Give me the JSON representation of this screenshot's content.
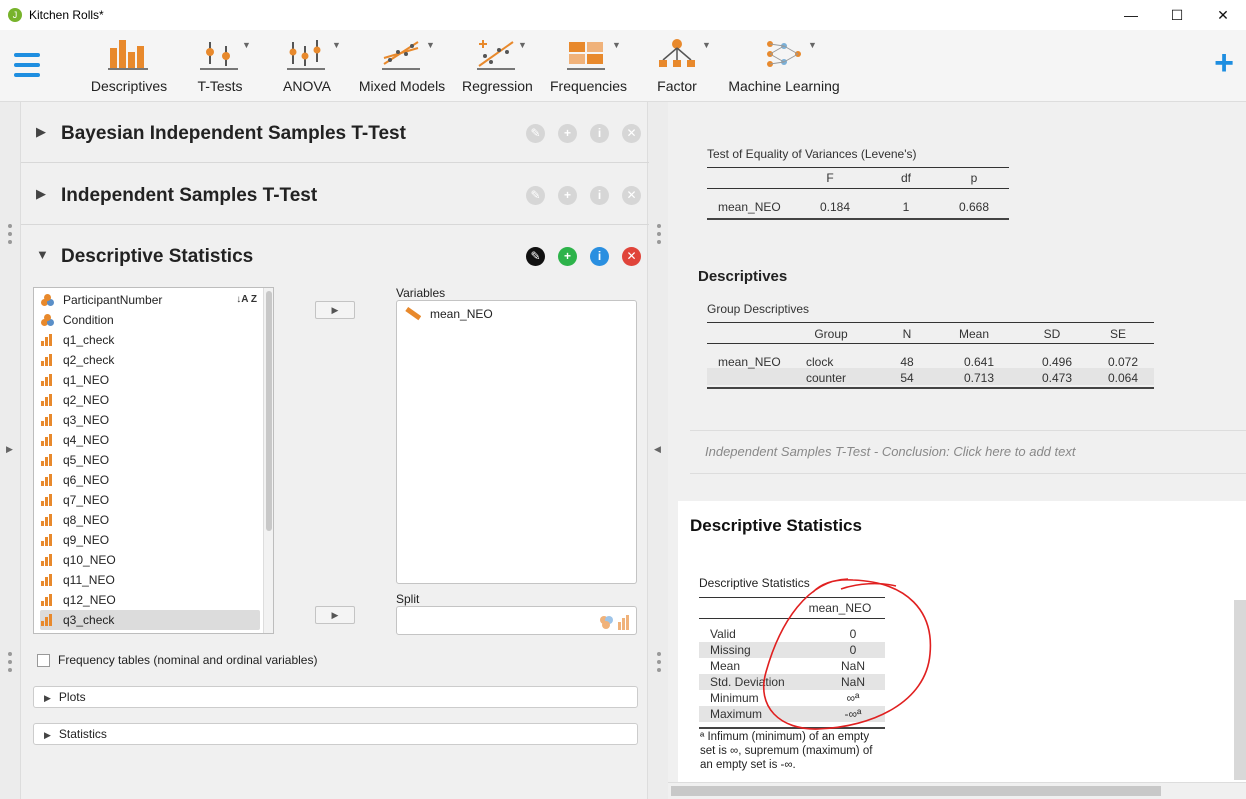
{
  "window": {
    "title": "Kitchen Rolls*",
    "minimize": "—",
    "maximize": "☐",
    "close": "✕"
  },
  "ribbon": {
    "tools": [
      {
        "label": "Descriptives"
      },
      {
        "label": "T-Tests"
      },
      {
        "label": "ANOVA"
      },
      {
        "label": "Mixed Models"
      },
      {
        "label": "Regression"
      },
      {
        "label": "Frequencies"
      },
      {
        "label": "Factor"
      },
      {
        "label": "Machine Learning"
      }
    ],
    "caret": "▼",
    "add": "+"
  },
  "analyses": [
    {
      "title": "Bayesian Independent Samples T-Test",
      "expanded": false,
      "arrow": "▶"
    },
    {
      "title": "Independent Samples T-Test",
      "expanded": false,
      "arrow": "▶"
    },
    {
      "title": "Descriptive Statistics",
      "expanded": true,
      "arrow": "▼"
    }
  ],
  "header_buttons": {
    "edit": "✎",
    "copy": "+",
    "info": "i",
    "close": "✕"
  },
  "colors": {
    "accent": "#1e8ee0",
    "green": "#2db34a",
    "red": "#e0443a",
    "blue": "#2a8fe0",
    "ordinal": "#e8892c",
    "annotation": "#e02020"
  },
  "descriptives_form": {
    "sort_label": "↓A Z",
    "move_arrow": "▶",
    "variables_label": "Variables",
    "split_label": "Split",
    "variables": [
      {
        "name": "ParticipantNumber",
        "type": "nominal"
      },
      {
        "name": "Condition",
        "type": "nominal"
      },
      {
        "name": "q1_check",
        "type": "scale"
      },
      {
        "name": "q2_check",
        "type": "scale"
      },
      {
        "name": "q1_NEO",
        "type": "scale"
      },
      {
        "name": "q2_NEO",
        "type": "scale"
      },
      {
        "name": "q3_NEO",
        "type": "scale"
      },
      {
        "name": "q4_NEO",
        "type": "scale"
      },
      {
        "name": "q5_NEO",
        "type": "scale"
      },
      {
        "name": "q6_NEO",
        "type": "scale"
      },
      {
        "name": "q7_NEO",
        "type": "scale"
      },
      {
        "name": "q8_NEO",
        "type": "scale"
      },
      {
        "name": "q9_NEO",
        "type": "scale"
      },
      {
        "name": "q10_NEO",
        "type": "scale"
      },
      {
        "name": "q11_NEO",
        "type": "scale"
      },
      {
        "name": "q12_NEO",
        "type": "scale"
      },
      {
        "name": "q3_check",
        "type": "scale",
        "selected": true
      }
    ],
    "assigned_variables": [
      "mean_NEO"
    ],
    "frequency_checkbox": "Frequency tables (nominal and ordinal variables)",
    "sections": [
      "Plots",
      "Statistics"
    ]
  },
  "results": {
    "levene": {
      "caption": "Test of Equality of Variances (Levene's)",
      "headers": [
        "",
        "F",
        "df",
        "p"
      ],
      "row": [
        "mean_NEO",
        "0.184",
        "1",
        "0.668"
      ]
    },
    "descriptives_heading": "Descriptives",
    "group_desc": {
      "caption": "Group Descriptives",
      "headers": [
        "",
        "Group",
        "N",
        "Mean",
        "SD",
        "SE"
      ],
      "rows": [
        [
          "mean_NEO",
          "clock",
          "48",
          "0.641",
          "0.496",
          "0.072"
        ],
        [
          "",
          "counter",
          "54",
          "0.713",
          "0.473",
          "0.064"
        ]
      ]
    },
    "conclusion": "Independent Samples T-Test - Conclusion: Click here to add text",
    "desc_stats": {
      "heading": "Descriptive Statistics",
      "caption": "Descriptive Statistics",
      "column": "mean_NEO",
      "rows": [
        [
          "Valid",
          "0"
        ],
        [
          "Missing",
          "0"
        ],
        [
          "Mean",
          "NaN"
        ],
        [
          "Std. Deviation",
          "NaN"
        ],
        [
          "Minimum",
          "∞ª"
        ],
        [
          "Maximum",
          "-∞ª"
        ]
      ],
      "footnote": "ª Infimum (minimum) of an empty set is ∞, supremum (maximum) of an empty set is -∞."
    }
  }
}
